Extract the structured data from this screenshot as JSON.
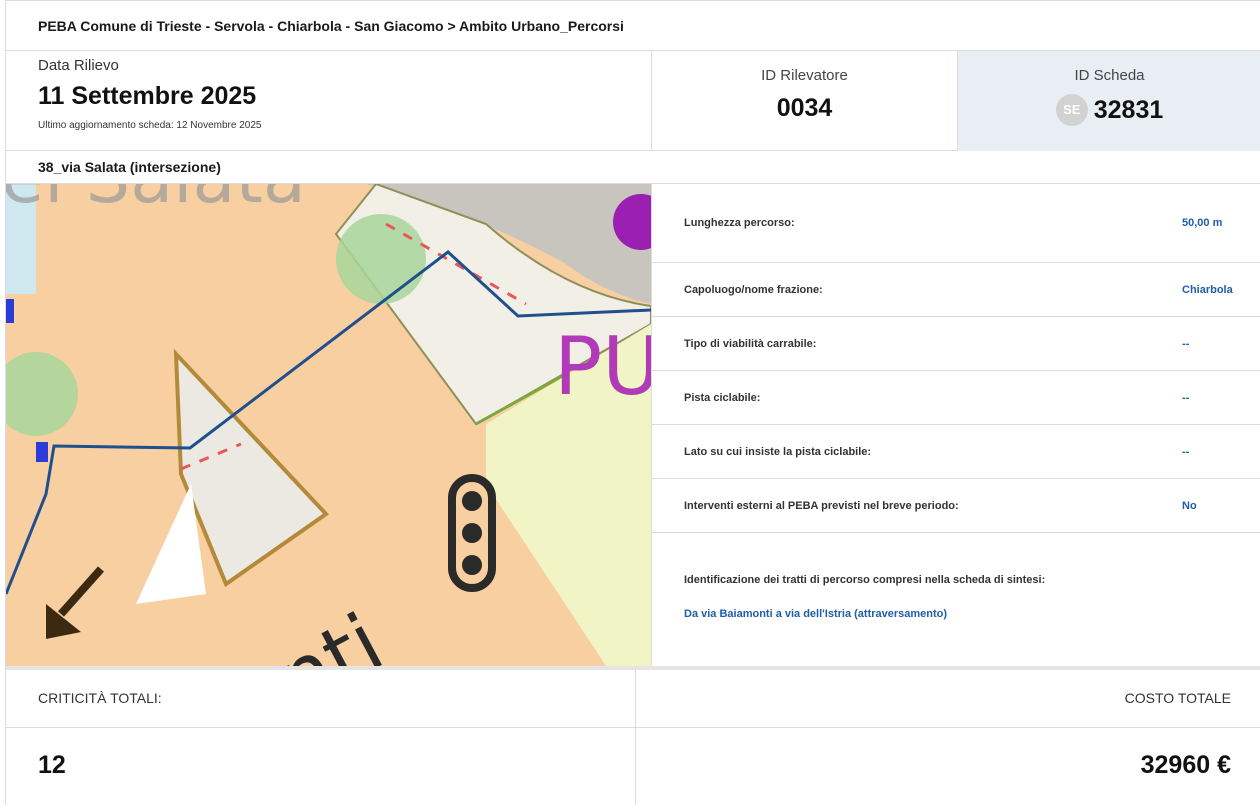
{
  "breadcrumb": "PEBA Comune di Trieste - Servola - Chiarbola - San Giacomo > Ambito Urbano_Percorsi",
  "header": {
    "date_label": "Data Rilievo",
    "date_value": "11 Settembre 2025",
    "last_update": "Ultimo aggiornamento scheda: 12 Novembre 2025",
    "rilevatore_label": "ID Rilevatore",
    "rilevatore_value": "0034",
    "scheda_label": "ID Scheda",
    "scheda_badge": "SE",
    "scheda_value": "32831"
  },
  "section_name": "38_via Salata (intersezione)",
  "map": {
    "labels": [
      "PU",
      "onti"
    ],
    "icon": "traffic-light-icon",
    "arrow": "arrow-down-left-icon"
  },
  "properties": [
    {
      "label": "Lunghezza percorso:",
      "value": "50,00 m"
    },
    {
      "label": "Capoluogo/nome frazione:",
      "value": "Chiarbola"
    },
    {
      "label": "Tipo di viabilità carrabile:",
      "value": "--"
    },
    {
      "label": "Pista ciclabile:",
      "value": "--"
    },
    {
      "label": "Lato su cui insiste la pista ciclabile:",
      "value": "--"
    },
    {
      "label": "Interventi esterni al PEBA previsti nel breve periodo:",
      "value": "No"
    }
  ],
  "tratti": {
    "label": "Identificazione dei tratti di percorso compresi nella scheda di sintesi:",
    "value": "Da via Baiamonti a via dell'Istria (attraversamento)"
  },
  "totals": {
    "criticita_label": "CRITICITÀ TOTALI:",
    "criticita_value": "12",
    "costo_label": "COSTO TOTALE",
    "costo_value": "32960 €"
  },
  "colors": {
    "accent": "#1f5ea8",
    "scheda_bg": "#e9eef5",
    "route": "#1f4f8c"
  }
}
